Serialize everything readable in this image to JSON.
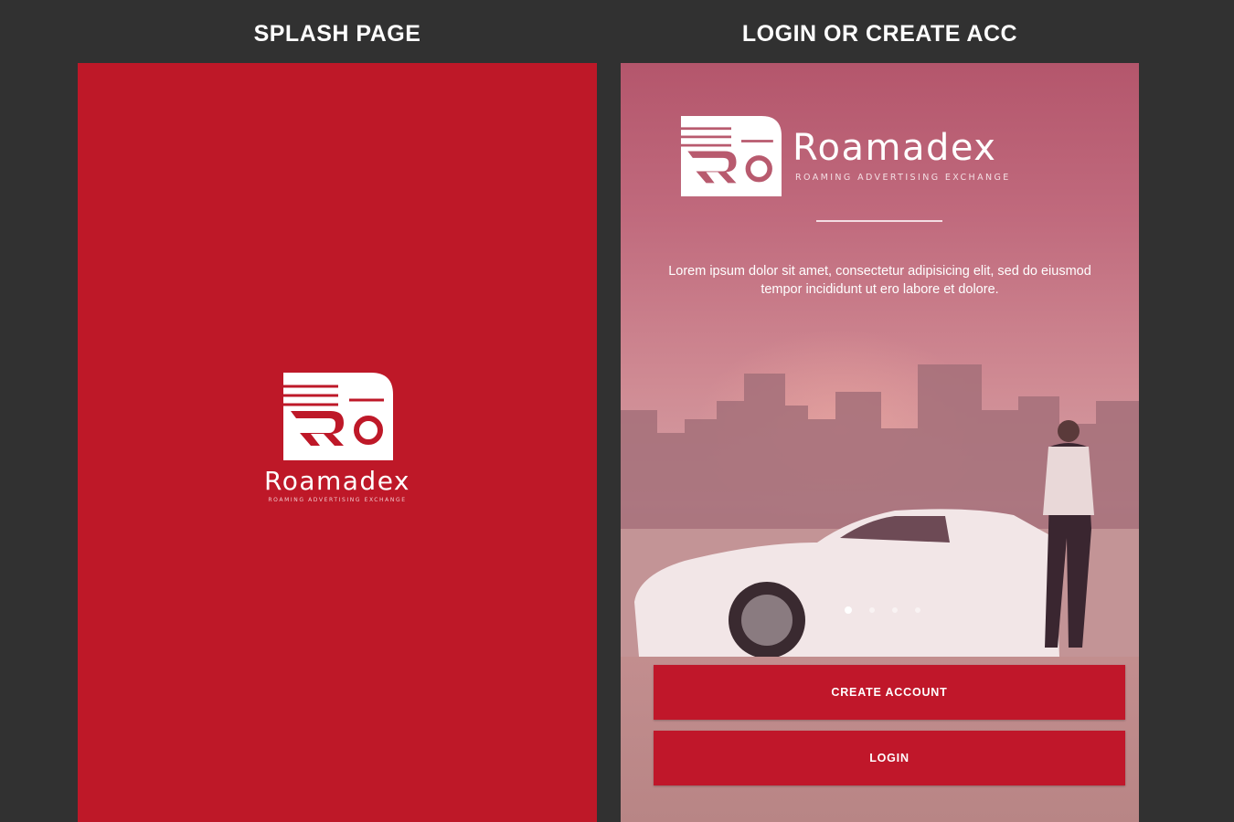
{
  "headings": {
    "splash": "SPLASH PAGE",
    "login": "LOGIN OR CREATE ACC"
  },
  "brand": {
    "name": "Roamadex",
    "tagline": "ROAMING ADVERTISING EXCHANGE"
  },
  "login_screen": {
    "description": "Lorem ipsum dolor sit amet, consectetur adipisicing elit, sed do eiusmod tempor incididunt ut ero labore et dolore.",
    "carousel": {
      "total": 4,
      "active": 1
    },
    "create_account_label": "CREATE ACCOUNT",
    "login_label": "LOGIN"
  },
  "colors": {
    "page_background": "#313131",
    "brand_red": "#be1828",
    "button_red": "#c0172a"
  }
}
